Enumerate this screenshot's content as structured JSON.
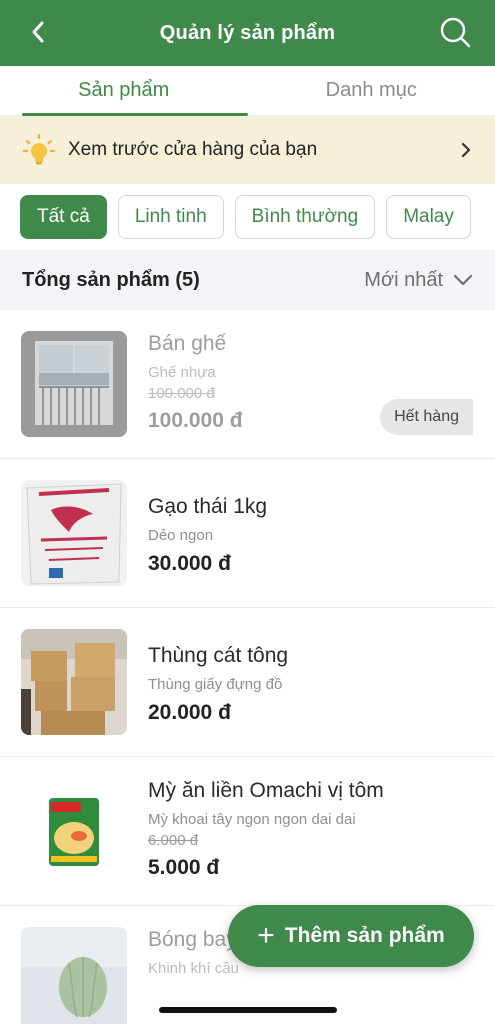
{
  "header": {
    "title": "Quản lý sản phẩm",
    "back_icon": "chevron-left-icon",
    "search_icon": "search-icon"
  },
  "tabs": [
    {
      "label": "Sản phẩm",
      "active": true
    },
    {
      "label": "Danh mục",
      "active": false
    }
  ],
  "banner": {
    "text": "Xem trước cửa hàng của bạn",
    "icon": "lightbulb-icon"
  },
  "filters": [
    {
      "label": "Tất cả",
      "active": true
    },
    {
      "label": "Linh tinh",
      "active": false
    },
    {
      "label": "Bình thường",
      "active": false
    },
    {
      "label": "Malay",
      "active": false
    }
  ],
  "summary": {
    "total": "Tổng sản phẩm (5)",
    "sort": "Mới nhất"
  },
  "products": [
    {
      "name": "Bán ghế",
      "desc": "Ghế nhựa",
      "old_price": "100.000 đ",
      "price": "100.000 đ",
      "badge": "Hết hàng"
    },
    {
      "name": "Gạo thái 1kg",
      "desc": "Dẻo ngon",
      "price": "30.000 đ"
    },
    {
      "name": "Thùng cát tông",
      "desc": "Thùng giấy đựng đồ",
      "price": "20.000 đ"
    },
    {
      "name": "Mỳ ăn liền Omachi vị tôm",
      "desc": "Mỳ khoai tây ngon ngon dai dai",
      "old_price": "6.000 đ",
      "price": "5.000 đ"
    },
    {
      "name": "Bóng bay",
      "desc": "Khinh khí cầu"
    }
  ],
  "fab": {
    "label": "Thêm sản phẩm"
  },
  "colors": {
    "primary": "#3f8a4b",
    "banner_bg": "#f6f0d9",
    "summary_bg": "#f3f4f8"
  }
}
